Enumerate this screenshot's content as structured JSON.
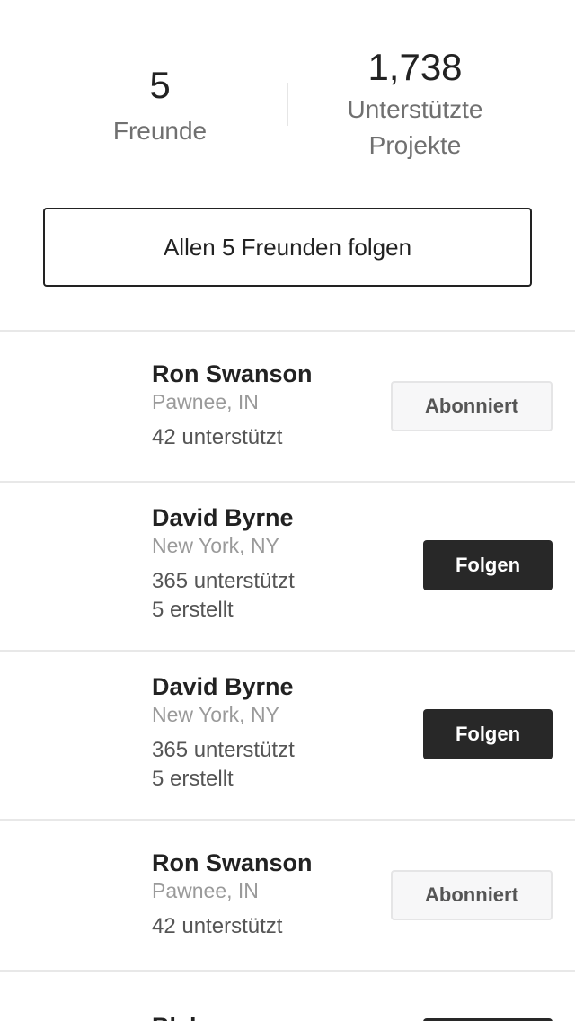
{
  "stats": {
    "friends_count": "5",
    "friends_label": "Freunde",
    "projects_count": "1,738",
    "projects_label_line1": "Unterstützte",
    "projects_label_line2": "Projekte"
  },
  "follow_all_label": "Allen 5 Freunden folgen",
  "friends": [
    {
      "name": "Ron Swanson",
      "location": "Pawnee, IN",
      "backed": "42 unterstützt",
      "created": "",
      "button": "Abonniert",
      "following": true
    },
    {
      "name": "David Byrne",
      "location": "New York, NY",
      "backed": "365 unterstützt",
      "created": "5 erstellt",
      "button": "Folgen",
      "following": false
    },
    {
      "name": "David Byrne",
      "location": "New York, NY",
      "backed": "365 unterstützt",
      "created": "5 erstellt",
      "button": "Folgen",
      "following": false
    },
    {
      "name": "Ron Swanson",
      "location": "Pawnee, IN",
      "backed": "42 unterstützt",
      "created": "",
      "button": "Abonniert",
      "following": true
    },
    {
      "name": "Blah",
      "location": "",
      "backed": "",
      "created": "",
      "button": "",
      "following": false
    }
  ]
}
